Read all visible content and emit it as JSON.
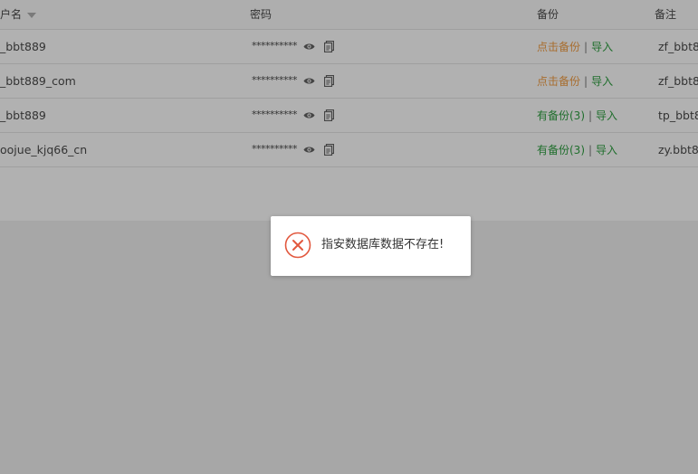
{
  "table": {
    "headers": {
      "username": "户名",
      "password": "密码",
      "backup": "备份",
      "note": "备注"
    },
    "rows": [
      {
        "username": "_bbt889",
        "password": "**********",
        "backup_action": "点击备份",
        "backup_style": "orange",
        "import": "导入",
        "note": "zf_bbt8"
      },
      {
        "username": "_bbt889_com",
        "password": "**********",
        "backup_action": "点击备份",
        "backup_style": "orange",
        "import": "导入",
        "note": "zf_bbt8"
      },
      {
        "username": "_bbt889",
        "password": "**********",
        "backup_action": "有备份(3)",
        "backup_style": "green",
        "import": "导入",
        "note": "tp_bbt8"
      },
      {
        "username": "oojue_kjq66_cn",
        "password": "**********",
        "backup_action": "有备份(3)",
        "backup_style": "green",
        "import": "导入",
        "note": "zy.bbt8"
      }
    ],
    "separator": "|"
  },
  "dialog": {
    "message": "指安数据库数据不存在!",
    "icon": "error-circle-x-icon",
    "icon_color": "#e2583e"
  },
  "colors": {
    "orange_link": "#a86d2e",
    "green_link": "#1f6e2c",
    "overlay_bg": "#a7a7a7"
  }
}
